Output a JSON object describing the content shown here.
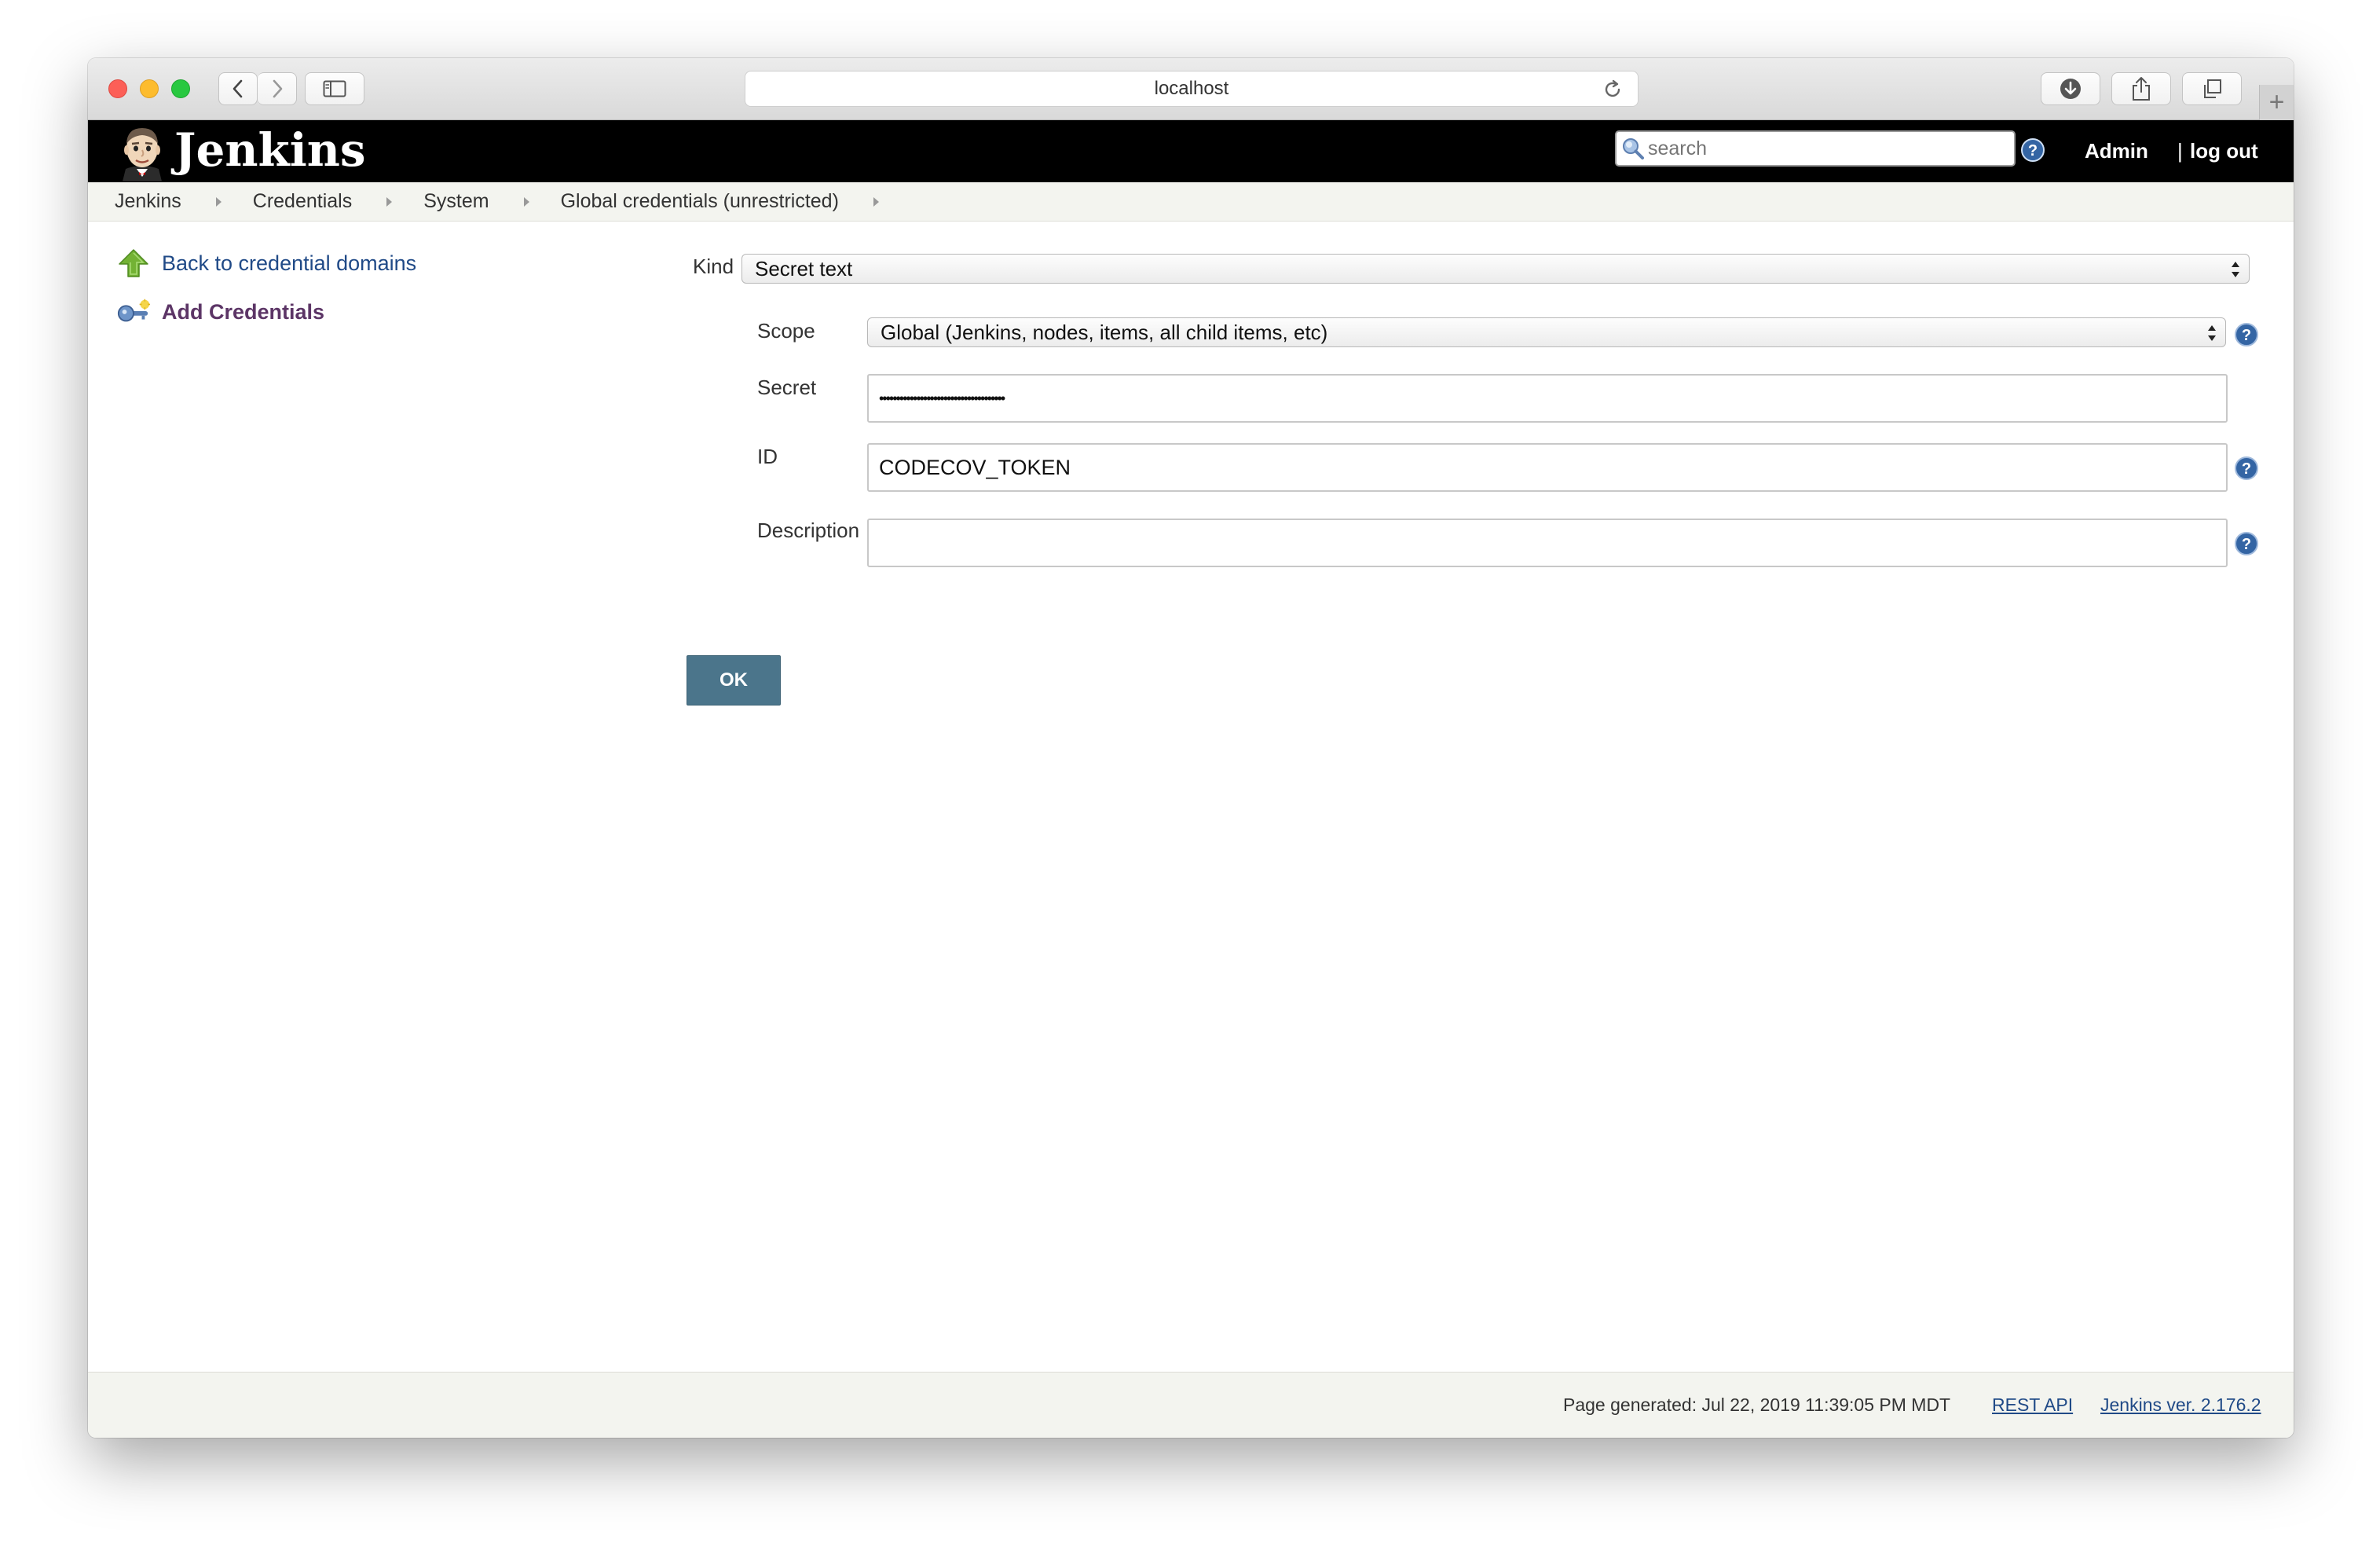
{
  "browser": {
    "url": "localhost"
  },
  "header": {
    "logo_text": "Jenkins",
    "search_placeholder": "search",
    "user": "Admin",
    "separator": "|",
    "logout": "log out"
  },
  "breadcrumb": {
    "items": [
      "Jenkins",
      "Credentials",
      "System",
      "Global credentials (unrestricted)"
    ]
  },
  "side_panel": {
    "back_label": "Back to credential domains",
    "add_label": "Add Credentials"
  },
  "form": {
    "kind_label": "Kind",
    "kind_value": "Secret text",
    "scope_label": "Scope",
    "scope_value": "Global (Jenkins, nodes, items, all child items, etc)",
    "secret_label": "Secret",
    "secret_value": "•••••••••••••••••••••••••••••••••••••",
    "id_label": "ID",
    "id_value": "CODECOV_TOKEN",
    "description_label": "Description",
    "description_value": "",
    "ok_label": "OK"
  },
  "footer": {
    "generated": "Page generated: Jul 22, 2019 11:39:05 PM MDT",
    "rest_api": "REST API",
    "version": "Jenkins ver. 2.176.2"
  },
  "colors": {
    "header_bg": "#000000",
    "breadcrumb_bg": "#f3f4ef",
    "link_blue": "#204a87",
    "ok_button": "#4b758b",
    "help_icon": "#3465a4"
  }
}
